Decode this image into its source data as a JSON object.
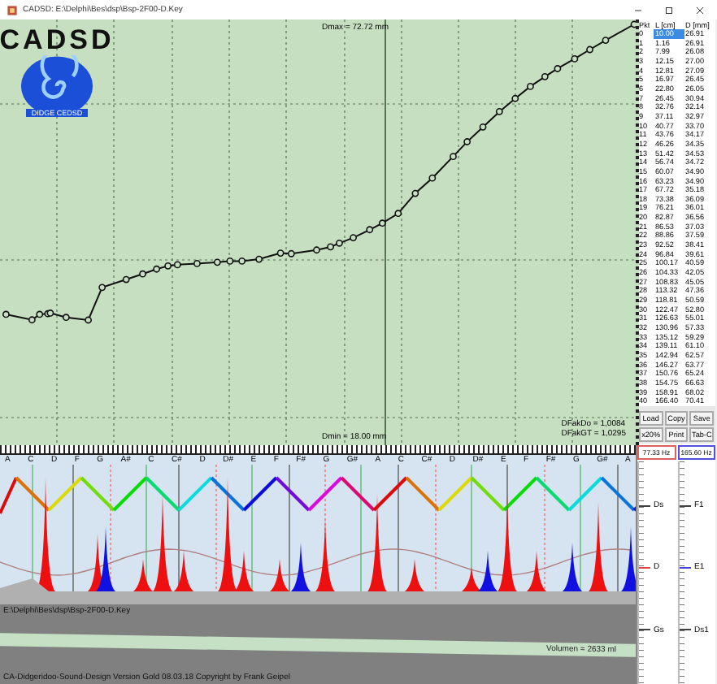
{
  "window": {
    "title": "CADSD: E:\\Delphi\\Bes\\dsp\\Bsp-2F00-D.Key"
  },
  "logo": {
    "name": "CADSD",
    "tagline": "DIDGE CEDSD"
  },
  "plot": {
    "dmax": "Dmax = 72.72 mm",
    "dmin": "Dmin = 18.00 mm",
    "factors": [
      "DFakDo = 1,0084",
      "DFakGT = 1,0295"
    ]
  },
  "table": {
    "columns": [
      "Pkt",
      "L [cm]",
      "D [mm]"
    ],
    "rows": [
      {
        "cells": [
          "0",
          "10.00",
          "26.91"
        ],
        "selected": true
      },
      {
        "cells": [
          "1",
          "1.16",
          "26.91"
        ],
        "selected": false
      },
      {
        "cells": [
          "2",
          "7.99",
          "26.08"
        ],
        "selected": false
      },
      {
        "cells": [
          "3",
          "12.15",
          "27.00"
        ],
        "selected": false
      },
      {
        "cells": [
          "4",
          "12.81",
          "27.09"
        ],
        "selected": false
      },
      {
        "cells": [
          "5",
          "16.97",
          "26.45"
        ],
        "selected": false
      },
      {
        "cells": [
          "6",
          "22.80",
          "26.05"
        ],
        "selected": false
      },
      {
        "cells": [
          "7",
          "26.45",
          "30.94"
        ],
        "selected": false
      },
      {
        "cells": [
          "8",
          "32.76",
          "32.14"
        ],
        "selected": false
      },
      {
        "cells": [
          "9",
          "37.11",
          "32.97"
        ],
        "selected": false
      },
      {
        "cells": [
          "10",
          "40.77",
          "33.70"
        ],
        "selected": false
      },
      {
        "cells": [
          "11",
          "43.76",
          "34.17"
        ],
        "selected": false
      },
      {
        "cells": [
          "12",
          "46.26",
          "34.35"
        ],
        "selected": false
      },
      {
        "cells": [
          "13",
          "51.42",
          "34.53"
        ],
        "selected": false
      },
      {
        "cells": [
          "14",
          "56.74",
          "34.72"
        ],
        "selected": false
      },
      {
        "cells": [
          "15",
          "60.07",
          "34.90"
        ],
        "selected": false
      },
      {
        "cells": [
          "16",
          "63.23",
          "34.90"
        ],
        "selected": false
      },
      {
        "cells": [
          "17",
          "67.72",
          "35.18"
        ],
        "selected": false
      },
      {
        "cells": [
          "18",
          "73.38",
          "36.09"
        ],
        "selected": false
      },
      {
        "cells": [
          "19",
          "76.21",
          "36.01"
        ],
        "selected": false
      },
      {
        "cells": [
          "20",
          "82.87",
          "36.56"
        ],
        "selected": false
      },
      {
        "cells": [
          "21",
          "86.53",
          "37.03"
        ],
        "selected": false
      },
      {
        "cells": [
          "22",
          "88.86",
          "37.59"
        ],
        "selected": false
      },
      {
        "cells": [
          "23",
          "92.52",
          "38.41"
        ],
        "selected": false
      },
      {
        "cells": [
          "24",
          "96.84",
          "39.61"
        ],
        "selected": false
      },
      {
        "cells": [
          "25",
          "100.17",
          "40.59"
        ],
        "selected": false
      },
      {
        "cells": [
          "26",
          "104.33",
          "42.05"
        ],
        "selected": false
      },
      {
        "cells": [
          "27",
          "108.83",
          "45.05"
        ],
        "selected": false
      },
      {
        "cells": [
          "28",
          "113.32",
          "47.36"
        ],
        "selected": false
      },
      {
        "cells": [
          "29",
          "118.81",
          "50.59"
        ],
        "selected": false
      },
      {
        "cells": [
          "30",
          "122.47",
          "52.80"
        ],
        "selected": false
      },
      {
        "cells": [
          "31",
          "126.63",
          "55.01"
        ],
        "selected": false
      },
      {
        "cells": [
          "32",
          "130.96",
          "57.33"
        ],
        "selected": false
      },
      {
        "cells": [
          "33",
          "135.12",
          "59.29"
        ],
        "selected": false
      },
      {
        "cells": [
          "34",
          "139.11",
          "61.10"
        ],
        "selected": false
      },
      {
        "cells": [
          "35",
          "142.94",
          "62.57"
        ],
        "selected": false
      },
      {
        "cells": [
          "36",
          "146.27",
          "63.77"
        ],
        "selected": false
      },
      {
        "cells": [
          "37",
          "150.76",
          "65.24"
        ],
        "selected": false
      },
      {
        "cells": [
          "38",
          "154.75",
          "66.63"
        ],
        "selected": false
      },
      {
        "cells": [
          "39",
          "158.91",
          "68.02"
        ],
        "selected": false
      },
      {
        "cells": [
          "40",
          "166.40",
          "70.41"
        ],
        "selected": false
      }
    ]
  },
  "buttons": [
    "Load",
    "Copy",
    "Save",
    "x20%",
    "Print",
    "Tab-C"
  ],
  "frequency_fields": [
    {
      "value": "77.33 Hz",
      "color": "#e06060"
    },
    {
      "value": "165.60 Hz",
      "color": "#5050e0"
    }
  ],
  "scales": [
    {
      "marks": [
        {
          "label": "Ds",
          "color": "#404040"
        },
        {
          "label": "D",
          "color": "#e04040"
        },
        {
          "label": "Gs",
          "color": "#404040"
        }
      ]
    },
    {
      "marks": [
        {
          "label": "F1",
          "color": "#404040"
        },
        {
          "label": "E1",
          "color": "#4040e0"
        },
        {
          "label": "Ds1",
          "color": "#404040"
        }
      ]
    }
  ],
  "spectrum": {
    "notes": [
      "A",
      "C",
      "D",
      "F",
      "G",
      "A#",
      "C",
      "C#",
      "D",
      "D#",
      "E",
      "F",
      "F#",
      "G",
      "G#",
      "A",
      "C",
      "C#",
      "D",
      "D#",
      "E",
      "F",
      "F#",
      "G",
      "G#",
      "A"
    ]
  },
  "file_path": "E:\\Delphi\\Bes\\dsp\\Bsp-2F00-D.Key",
  "volume": "Volumen = 2633 ml",
  "copyright": "CA-Didgeridoo-Sound-Design Version Gold 08.03.18 Copyright by Frank Geipel"
}
